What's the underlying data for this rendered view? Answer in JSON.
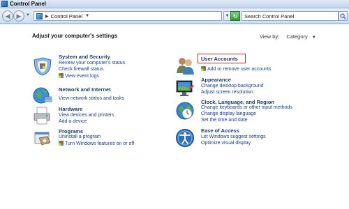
{
  "window": {
    "title": "Control Panel"
  },
  "navbar": {
    "address_label": "Control Panel",
    "search_placeholder": "Search Control Panel"
  },
  "main": {
    "heading": "Adjust your computer's settings",
    "view_by_label": "View by:",
    "view_by_value": "Category"
  },
  "categories": [
    {
      "title": "System and Security",
      "icon": "system-security-icon",
      "links": [
        "Review your computer's status",
        "Check firewall status",
        "View event logs"
      ]
    },
    {
      "title": "Network and Internet",
      "icon": "network-internet-icon",
      "links": [
        "View network status and tasks"
      ]
    },
    {
      "title": "Hardware",
      "icon": "hardware-printer-icon",
      "links": [
        "View devices and printers",
        "Add a device"
      ]
    },
    {
      "title": "Programs",
      "icon": "programs-icon",
      "links": [
        "Uninstall a program",
        "Turn Windows features on or off"
      ]
    },
    {
      "title": "User Accounts",
      "icon": "user-accounts-icon",
      "links": [
        "Add or remove user accounts"
      ]
    },
    {
      "title": "Appearance",
      "icon": "appearance-icon",
      "links": [
        "Change desktop background",
        "Adjust screen resolution"
      ]
    },
    {
      "title": "Clock, Language, and Region",
      "icon": "clock-globe-icon",
      "links": [
        "Change keyboards or other input methods",
        "Change display language",
        "Set the time and date"
      ]
    },
    {
      "title": "Ease of Access",
      "icon": "ease-of-access-icon",
      "links": [
        "Let Windows suggest settings",
        "Optimize visual display"
      ]
    }
  ],
  "colors": {
    "link": "#1a3f86",
    "category_title": "#1c3a6e",
    "highlight": "#d91f1f"
  }
}
